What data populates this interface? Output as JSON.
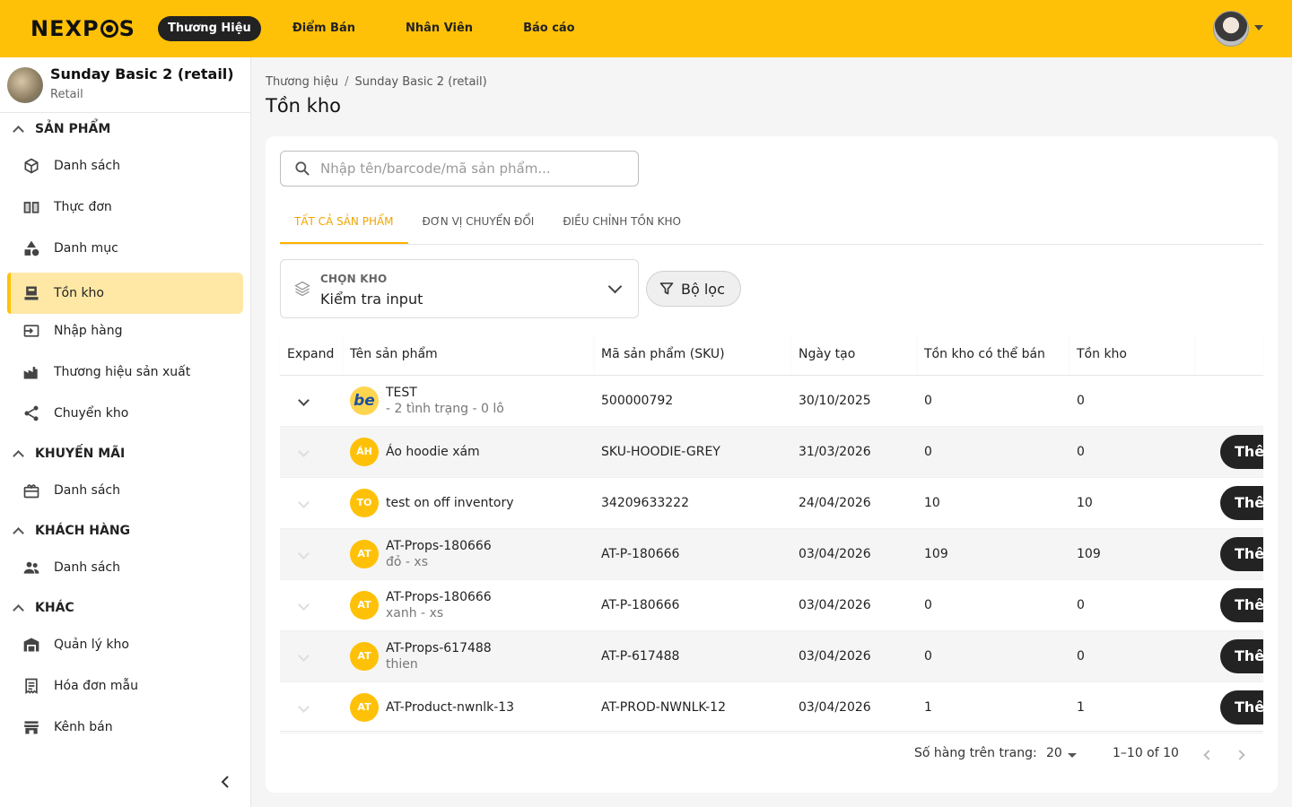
{
  "header": {
    "logo": "NEXPOS",
    "nav": [
      "Thương Hiệu",
      "Điểm Bán",
      "Nhân Viên",
      "Báo cáo"
    ]
  },
  "sidebar": {
    "store_name": "Sunday Basic 2 (retail)",
    "store_type": "Retail",
    "sections": {
      "products": {
        "title": "SẢN PHẨM",
        "items": [
          "Danh sách",
          "Thực đơn",
          "Danh mục",
          "Tồn kho",
          "Nhập hàng",
          "Thương hiệu sản xuất",
          "Chuyển kho"
        ]
      },
      "promotions": {
        "title": "KHUYẾN MÃI",
        "items": [
          "Danh sách"
        ]
      },
      "customers": {
        "title": "KHÁCH HÀNG",
        "items": [
          "Danh sách"
        ]
      },
      "other": {
        "title": "KHÁC",
        "items": [
          "Quản lý kho",
          "Hóa đơn mẫu",
          "Kênh bán"
        ]
      }
    }
  },
  "breadcrumb": [
    "Thương hiệu",
    "Sunday Basic 2 (retail)"
  ],
  "page_title": "Tồn kho",
  "search": {
    "placeholder": "Nhập tên/barcode/mã sản phẩm..."
  },
  "tabs": [
    "TẤT CẢ SẢN PHẨM",
    "ĐƠN VỊ CHUYỂN ĐỔI",
    "ĐIỀU CHỈNH TỒN KHO"
  ],
  "store_select": {
    "label": "CHỌN KHO",
    "value": "Kiểm tra input"
  },
  "filter_label": "Bộ lọc",
  "table": {
    "columns": [
      "Expand",
      "Tên sản phẩm",
      "Mã sản phẩm (SKU)",
      "Ngày tạo",
      "Tồn kho có thể bán",
      "Tồn kho"
    ],
    "rows": [
      {
        "avatar": "be",
        "name": "TEST",
        "sub": "- 2 tình trạng - 0 lô",
        "sku": "500000792",
        "date": "30/10/2025",
        "sellable": "0",
        "stock": "0",
        "action": ""
      },
      {
        "avatar": "ÁH",
        "name": "Áo hoodie xám",
        "sub": "",
        "sku": "SKU-HOODIE-GREY",
        "date": "31/03/2026",
        "sellable": "0",
        "stock": "0",
        "action": "Thêm b"
      },
      {
        "avatar": "TO",
        "name": "test on off inventory",
        "sub": "",
        "sku": "34209633222",
        "date": "24/04/2026",
        "sellable": "10",
        "stock": "10",
        "action": "Thêm b"
      },
      {
        "avatar": "AT",
        "name": "AT-Props-180666",
        "sub": "đỏ - xs",
        "sku": "AT-P-180666",
        "date": "03/04/2026",
        "sellable": "109",
        "stock": "109",
        "action": "Thêm b"
      },
      {
        "avatar": "AT",
        "name": "AT-Props-180666",
        "sub": "xanh - xs",
        "sku": "AT-P-180666",
        "date": "03/04/2026",
        "sellable": "0",
        "stock": "0",
        "action": "Thêm b"
      },
      {
        "avatar": "AT",
        "name": "AT-Props-617488",
        "sub": "thien",
        "sku": "AT-P-617488",
        "date": "03/04/2026",
        "sellable": "0",
        "stock": "0",
        "action": "Thêm b"
      },
      {
        "avatar": "AT",
        "name": "AT-Product-nwnlk-13",
        "sub": "",
        "sku": "AT-PROD-NWNLK-12",
        "date": "03/04/2026",
        "sellable": "1",
        "stock": "1",
        "action": "Thêm b"
      }
    ]
  },
  "pagination": {
    "rows_per_page_label": "Số hàng trên trang:",
    "rows_per_page": "20",
    "range": "1–10 of 10"
  },
  "colors": {
    "brand": "#ffc107",
    "active_tab": "#f0a500",
    "dark_button": "#232323",
    "active_item_bg": "#ffe8a6"
  },
  "icons": [
    "search-icon",
    "filter-icon",
    "layers-icon",
    "chevron-down-icon",
    "chevron-left-icon",
    "chevron-right-icon",
    "box-icon",
    "menu-book-icon",
    "category-icon",
    "inventory-icon",
    "import-icon",
    "factory-icon",
    "share-icon",
    "gift-icon",
    "people-icon",
    "warehouse-icon",
    "receipt-icon",
    "store-icon"
  ]
}
